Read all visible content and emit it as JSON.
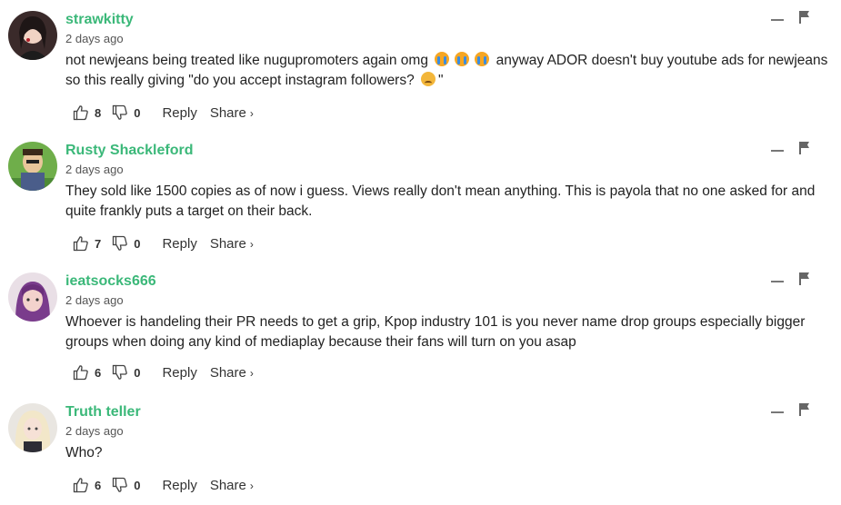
{
  "comments": [
    {
      "username": "strawkitty",
      "timestamp": "2 days ago",
      "text_parts": [
        "not newjeans being treated like nugupromoters again omg ",
        " anyway ADOR doesn't buy youtube ads for newjeans so this really giving \"do you accept instagram followers? ",
        "\""
      ],
      "likes": "8",
      "dislikes": "0",
      "reply_label": "Reply",
      "share_label": "Share",
      "avatar_colors": [
        "#2b2b2b",
        "#f1d3c4",
        "#b0202a"
      ]
    },
    {
      "username": "Rusty Shackleford",
      "timestamp": "2 days ago",
      "text": "They sold like 1500 copies as of now i guess. Views really don't mean anything. This is payola that no one asked for and quite frankly puts a target on their back.",
      "likes": "7",
      "dislikes": "0",
      "reply_label": "Reply",
      "share_label": "Share",
      "avatar_colors": [
        "#6fae4a",
        "#e8c69a",
        "#4a5d8a"
      ]
    },
    {
      "username": "ieatsocks666",
      "timestamp": "2 days ago",
      "text": "Whoever is handeling their PR needs to get a grip, Kpop industry 101 is you never name drop groups especially bigger groups when doing any kind of mediaplay because their fans will turn on you asap",
      "likes": "6",
      "dislikes": "0",
      "reply_label": "Reply",
      "share_label": "Share",
      "avatar_colors": [
        "#e9dfe6",
        "#7a3c8c",
        "#f3d2cc"
      ]
    },
    {
      "username": "Truth teller",
      "timestamp": "2 days ago",
      "text": "Who?",
      "likes": "6",
      "dislikes": "0",
      "reply_label": "Reply",
      "share_label": "Share",
      "avatar_colors": [
        "#e9e6e1",
        "#f2e7c9",
        "#2d2d35"
      ]
    }
  ],
  "icons": {
    "like": "thumbs-up-icon",
    "dislike": "thumbs-down-icon",
    "collapse": "minus-icon",
    "flag": "flag-icon",
    "share_chevron": "›"
  },
  "accent_color": "#3bb879"
}
